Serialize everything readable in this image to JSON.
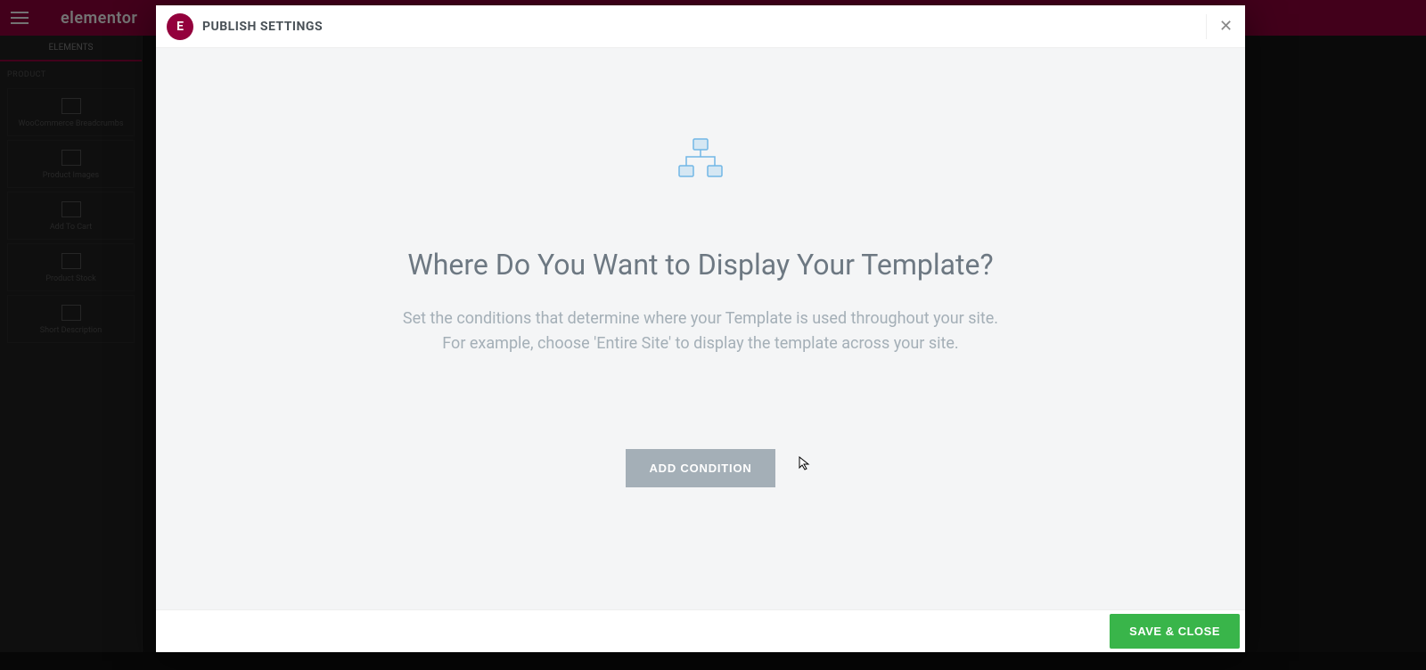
{
  "background": {
    "brand": "elementor",
    "tabs": {
      "elements": "ELEMENTS"
    },
    "category": "PRODUCT",
    "widgets": [
      "WooCommerce Breadcrumbs",
      "Product Images",
      "Add To Cart",
      "Product Stock",
      "Short Description"
    ]
  },
  "modal": {
    "logo_letter": "E",
    "title": "PUBLISH SETTINGS",
    "close_label": "✕",
    "heading": "Where Do You Want to Display Your Template?",
    "description_line1": "Set the conditions that determine where your Template is used throughout your site.",
    "description_line2": "For example, choose 'Entire Site' to display the template across your site.",
    "add_condition_label": "ADD CONDITION",
    "save_label": "SAVE & CLOSE"
  }
}
